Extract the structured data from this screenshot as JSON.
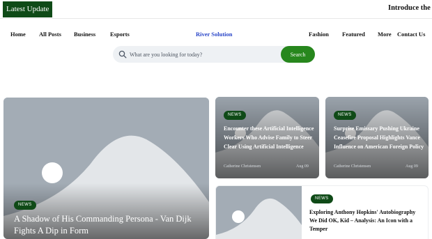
{
  "topbar": {
    "latest_label": "Latest Update",
    "ticker_text": "Introduce the"
  },
  "nav": {
    "left": [
      "Home",
      "All Posts",
      "Business",
      "Esports"
    ],
    "center": "River Solution",
    "right": [
      "Fashion",
      "Featured",
      "More",
      "Contact Us"
    ]
  },
  "search": {
    "placeholder": "What are you looking for today?",
    "button": "Search",
    "icon": "search-icon"
  },
  "colors": {
    "badge": "#0f4a17",
    "search_button": "#27871d",
    "active_nav": "#2a46c8",
    "placeholder_bg": "#a3acb5"
  },
  "hero": {
    "badge": "NEWS",
    "title": "A Shadow of His Commanding Persona - Van Dijk Fights A Dip in Form"
  },
  "cards": [
    {
      "badge": "NEWS",
      "title": "Encounter these Artificial Intelligence Workers Who Advise Family to Steer Clear Using Artificial Intelligence",
      "author": "Catherine Christensen",
      "date": "Aug 09"
    },
    {
      "badge": "NEWS",
      "title": "Surprise Emissary Pushing Ukraine Ceasefire Proposal Highlights Vance Influence on American Foreign Policy",
      "author": "Catherine Christensen",
      "date": "Aug 09"
    }
  ],
  "horizontal_card": {
    "badge": "NEWS",
    "title": "Exploring Anthony Hopkins' Autobiography We Did OK, Kid – Analysis: An Icon with a Temper"
  }
}
